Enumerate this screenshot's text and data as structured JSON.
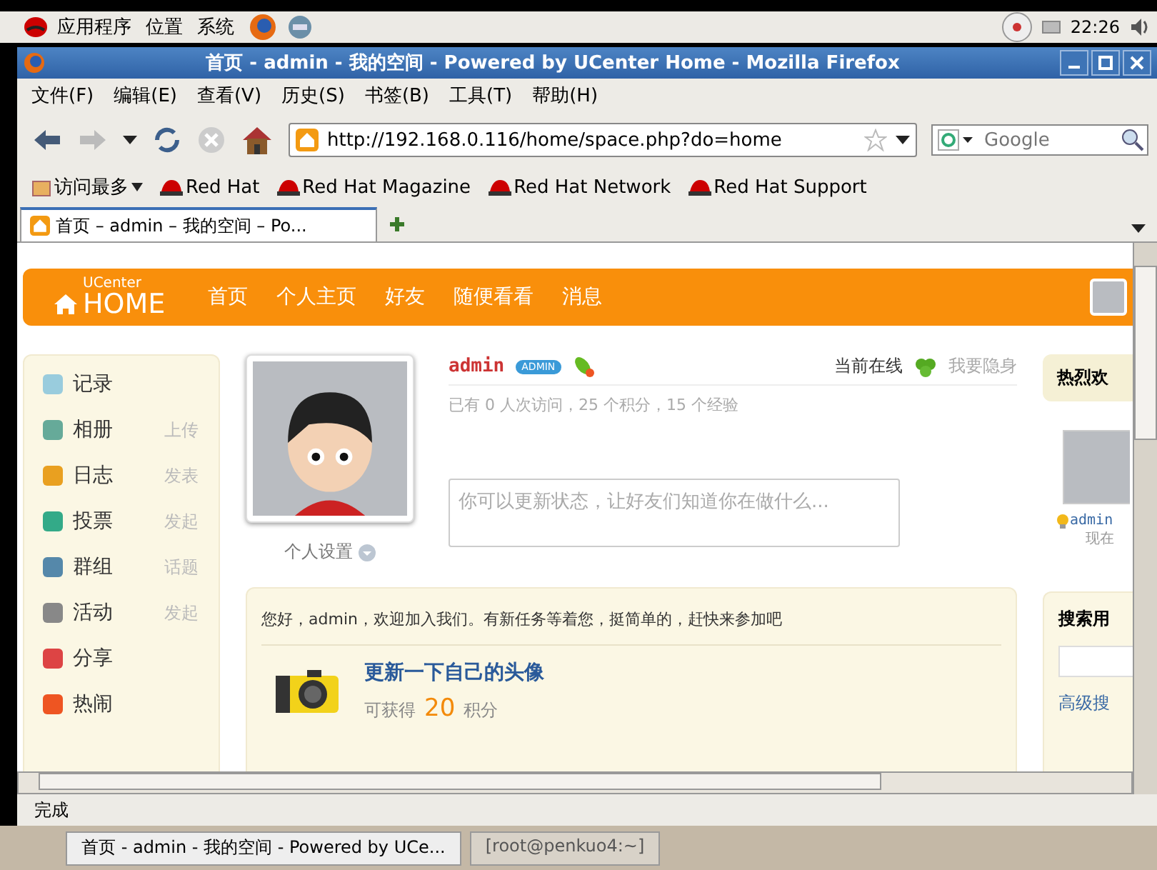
{
  "top_panel": {
    "menus": [
      "应用程序",
      "位置",
      "系统"
    ],
    "clock": "22:26"
  },
  "window": {
    "title": "首页 -  admin - 我的空间 -  Powered by UCenter Home - Mozilla Firefox"
  },
  "menu": [
    "文件(F)",
    "编辑(E)",
    "查看(V)",
    "历史(S)",
    "书签(B)",
    "工具(T)",
    "帮助(H)"
  ],
  "toolbar": {
    "url": "http://192.168.0.116/home/space.php?do=home",
    "search_placeholder": "Google"
  },
  "bookmarks": [
    {
      "label": "访问最多",
      "kind": "menu"
    },
    {
      "label": "Red Hat",
      "kind": "link"
    },
    {
      "label": "Red Hat Magazine",
      "kind": "link"
    },
    {
      "label": "Red Hat Network",
      "kind": "link"
    },
    {
      "label": "Red Hat Support",
      "kind": "link"
    }
  ],
  "tabs": [
    {
      "label": "首页 – admin – 我的空间 – Po...",
      "selected": true
    }
  ],
  "page": {
    "brand_small": "UCenter",
    "brand_big": "HOME",
    "nav": [
      "首页",
      "个人主页",
      "好友",
      "随便看看",
      "消息"
    ],
    "sidebar": [
      {
        "label": "记录"
      },
      {
        "label": "相册",
        "action": "上传"
      },
      {
        "label": "日志",
        "action": "发表"
      },
      {
        "label": "投票",
        "action": "发起"
      },
      {
        "label": "群组",
        "action": "话题"
      },
      {
        "label": "活动",
        "action": "发起"
      },
      {
        "label": "分享"
      },
      {
        "label": "热闹"
      }
    ],
    "profile": {
      "settings": "个人设置",
      "name": "admin",
      "badge": "ADMIN",
      "online": "当前在线",
      "hide": "我要隐身",
      "stats": "已有 0 人次访问，25 个积分，15 个经验",
      "status_placeholder": "你可以更新状态，让好友们知道你在做什么..."
    },
    "task": {
      "greeting": "您好，admin，欢迎加入我们。有新任务等着您，挺简单的，赶快来参加吧",
      "title": "更新一下自己的头像",
      "reward_prefix": "可获得",
      "reward": "20",
      "reward_unit": "积分"
    },
    "right": {
      "welcome": "热烈欢",
      "user": "admin",
      "time": "现在",
      "search_title": "搜索用",
      "advanced": "高级搜"
    }
  },
  "status_bar": "完成",
  "taskbar": [
    {
      "label": "首页 - admin - 我的空间 - Powered by UCe...",
      "selected": true
    },
    {
      "label": "[root@penkuo4:~]",
      "selected": false
    }
  ]
}
